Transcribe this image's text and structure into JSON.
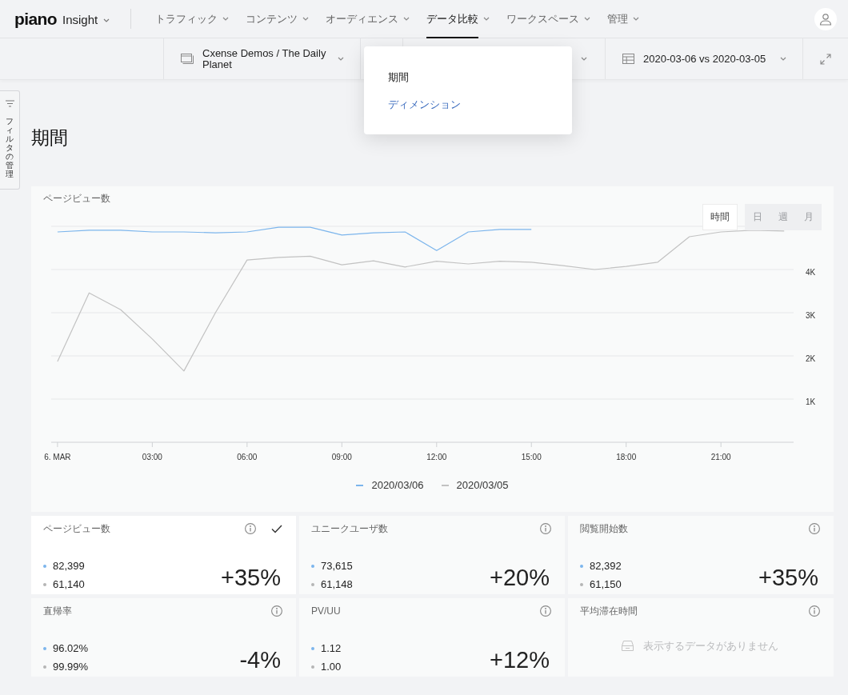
{
  "header": {
    "logo": "piano",
    "product": "Insight",
    "nav": [
      {
        "label": "トラフィック",
        "selected": false
      },
      {
        "label": "コンテンツ",
        "selected": false
      },
      {
        "label": "オーディエンス",
        "selected": false
      },
      {
        "label": "データ比較",
        "selected": true
      },
      {
        "label": "ワークスペース",
        "selected": false
      },
      {
        "label": "管理",
        "selected": false
      }
    ]
  },
  "context_bar": {
    "selectors": [
      {
        "kind": "site",
        "label": "Cxense Demos / The Daily Planet"
      },
      {
        "kind": "covered"
      },
      {
        "kind": "date",
        "label": "2020-03-06 vs 2020-03-05"
      }
    ]
  },
  "dropdown": {
    "items": [
      {
        "label": "期間",
        "hovered": false
      },
      {
        "label": "ディメンション",
        "hovered": true
      }
    ]
  },
  "filter_tab": {
    "label": "フィルタの管理"
  },
  "page_title": "期間",
  "chart_panel": {
    "granularity": [
      {
        "label": "時間",
        "selected": true,
        "disabled": false
      },
      {
        "label": "日",
        "selected": false,
        "disabled": true
      },
      {
        "label": "週",
        "selected": false,
        "disabled": true
      },
      {
        "label": "月",
        "selected": false,
        "disabled": true
      }
    ],
    "chart_data": {
      "type": "line",
      "title": "ページビュー数",
      "grid": true,
      "x": [
        0,
        1,
        2,
        3,
        4,
        5,
        6,
        7,
        8,
        9,
        10,
        11,
        12,
        13,
        14,
        15,
        16,
        17,
        18,
        19,
        20,
        21,
        22,
        23
      ],
      "xlim": [
        -0.2,
        23.3
      ],
      "xticks": [
        {
          "value": 0,
          "label": "6. MAR"
        },
        {
          "value": 3,
          "label": "03:00"
        },
        {
          "value": 6,
          "label": "06:00"
        },
        {
          "value": 9,
          "label": "09:00"
        },
        {
          "value": 12,
          "label": "12:00"
        },
        {
          "value": 15,
          "label": "15:00"
        },
        {
          "value": 18,
          "label": "18:00"
        },
        {
          "value": 21,
          "label": "21:00"
        }
      ],
      "ylim": [
        0,
        5000
      ],
      "yticks": [
        {
          "value": 1000,
          "label": "1K"
        },
        {
          "value": 2000,
          "label": "2K"
        },
        {
          "value": 3000,
          "label": "3K"
        },
        {
          "value": 4000,
          "label": "4K"
        }
      ],
      "series": [
        {
          "name": "2020/03/06",
          "color": "#7cb5ec",
          "values": [
            4870,
            4910,
            4910,
            4870,
            4870,
            4850,
            4870,
            4980,
            4980,
            4800,
            4850,
            4870,
            4440,
            4870,
            4930,
            4930,
            null,
            null,
            null,
            null,
            null,
            null,
            null,
            null
          ]
        },
        {
          "name": "2020/03/05",
          "color": "#c2c2c2",
          "values": [
            1870,
            3460,
            3070,
            2390,
            1650,
            3000,
            4220,
            4280,
            4310,
            4110,
            4200,
            4060,
            4190,
            4130,
            4190,
            4170,
            4090,
            4000,
            4070,
            4170,
            4760,
            4870,
            4910,
            4890
          ]
        }
      ]
    }
  },
  "metrics": [
    {
      "kind": "values",
      "title": "ページビュー数",
      "selected": true,
      "current": "82,399",
      "previous": "61,140",
      "change": "+35%"
    },
    {
      "kind": "values",
      "title": "ユニークユーザ数",
      "selected": false,
      "current": "73,615",
      "previous": "61,148",
      "change": "+20%"
    },
    {
      "kind": "values",
      "title": "閲覧開始数",
      "selected": false,
      "current": "82,392",
      "previous": "61,150",
      "change": "+35%"
    },
    {
      "kind": "values",
      "title": "直帰率",
      "selected": false,
      "current": "96.02%",
      "previous": "99.99%",
      "change": "-4%"
    },
    {
      "kind": "values",
      "title": "PV/UU",
      "selected": false,
      "current": "1.12",
      "previous": "1.00",
      "change": "+12%"
    },
    {
      "kind": "empty",
      "title": "平均滞在時間",
      "selected": false,
      "empty_message": "表示するデータがありません"
    }
  ]
}
